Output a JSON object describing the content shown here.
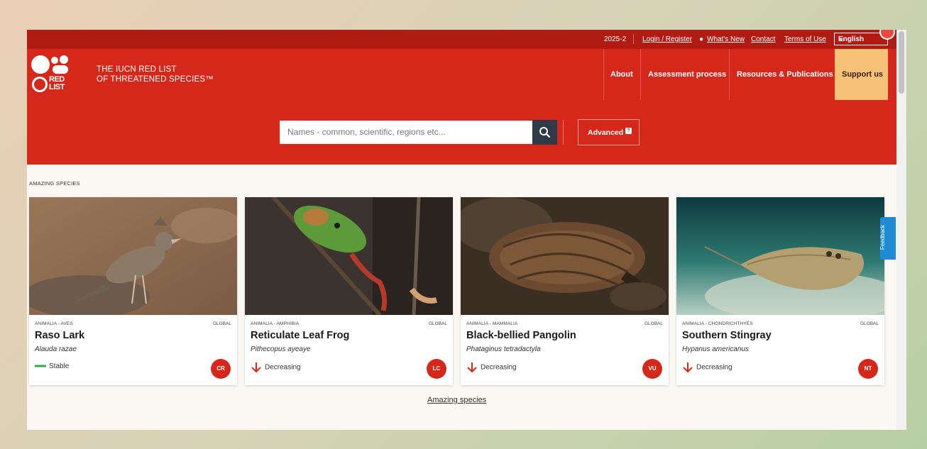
{
  "topbar": {
    "version": "2025-2",
    "login": "Login / Register",
    "whats_new": "What's New",
    "contact": "Contact",
    "terms": "Terms of Use",
    "language": "English"
  },
  "header": {
    "logo_text": "RED LIST",
    "brand_line1": "THE IUCN RED LIST",
    "brand_line2": "OF THREATENED SPECIES™",
    "nav": [
      "About",
      "Assessment process",
      "Resources & Publications"
    ],
    "support": "Support us"
  },
  "search": {
    "placeholder": "Names - common, scientific, regions etc...",
    "advanced": "Advanced",
    "advanced_help": "?"
  },
  "section_title": "AMAZING SPECIES",
  "cards": [
    {
      "taxon": "ANIMALIA - AVES",
      "scope": "GLOBAL",
      "common": "Raso Lark",
      "scientific": "Alauda razae",
      "trend": "Stable",
      "category": "CR"
    },
    {
      "taxon": "ANIMALIA - AMPHIBIA",
      "scope": "GLOBAL",
      "common": "Reticulate Leaf Frog",
      "scientific": "Pithecopus ayeaye",
      "trend": "Decreasing",
      "category": "LC"
    },
    {
      "taxon": "ANIMALIA - MAMMALIA",
      "scope": "GLOBAL",
      "common": "Black-bellied Pangolin",
      "scientific": "Phataginus tetradactyla",
      "trend": "Decreasing",
      "category": "VU"
    },
    {
      "taxon": "ANIMALIA - CHONDRICHTHYES",
      "scope": "GLOBAL",
      "common": "Southern Stingray",
      "scientific": "Hypanus americanus",
      "trend": "Decreasing",
      "category": "NT"
    }
  ],
  "footer_link": "Amazing species",
  "feedback": "Feedback",
  "colors": {
    "brand_red": "#d5281b",
    "dark_red": "#b01c14",
    "support_bg": "#f7c277",
    "feedback_blue": "#1e8cd4"
  },
  "icons": {
    "search": "search-icon",
    "stable": "trend-stable-icon",
    "decreasing": "trend-decreasing-icon"
  }
}
